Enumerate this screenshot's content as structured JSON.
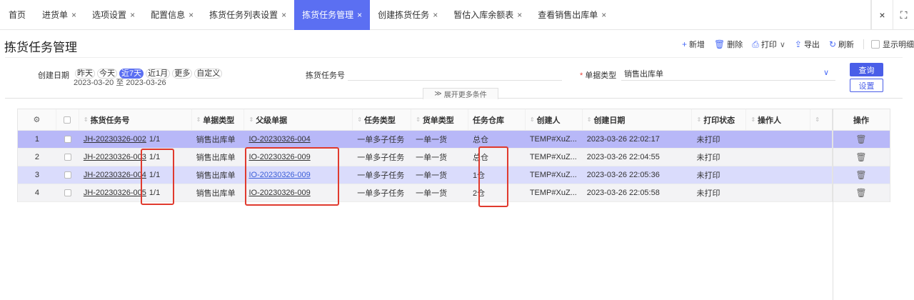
{
  "tabs": [
    {
      "label": "首页",
      "closable": false,
      "active": false
    },
    {
      "label": "进货单",
      "closable": true,
      "active": false
    },
    {
      "label": "选项设置",
      "closable": true,
      "active": false
    },
    {
      "label": "配置信息",
      "closable": true,
      "active": false
    },
    {
      "label": "拣货任务列表设置",
      "closable": true,
      "active": false
    },
    {
      "label": "拣货任务管理",
      "closable": true,
      "active": true
    },
    {
      "label": "创建拣货任务",
      "closable": true,
      "active": false
    },
    {
      "label": "暂估入库余额表",
      "closable": true,
      "active": false
    },
    {
      "label": "查看销售出库单",
      "closable": true,
      "active": false
    }
  ],
  "tab_close_glyph": "×",
  "window_controls": {
    "close": "×",
    "fullscreen": "⛶"
  },
  "page_title": "拣货任务管理",
  "toolbar": {
    "add": "新增",
    "delete": "删除",
    "print": "打印",
    "export": "导出",
    "refresh": "刷新",
    "show_detail": "显示明细"
  },
  "filter": {
    "date_label": "创建日期",
    "date_options": [
      "昨天",
      "今天",
      "近7天",
      "近1月",
      "更多",
      "自定义"
    ],
    "date_selected": "近7天",
    "date_range": "2023-03-20 至 2023-03-26",
    "task_no_label": "拣货任务号",
    "task_no_value": "",
    "type_label": "单据类型",
    "type_value": "销售出库单",
    "query_btn": "查询",
    "setting_btn": "设置",
    "expand_label": "展开更多条件"
  },
  "table": {
    "columns": [
      "拣货任务号",
      "单据类型",
      "父级单据",
      "任务类型",
      "货单类型",
      "任务仓库",
      "创建人",
      "创建日期",
      "打印状态",
      "操作人",
      "操作"
    ],
    "rows": [
      {
        "idx": "1",
        "task_no": "JH-20230326-002",
        "count": "1/1",
        "doc_type": "销售出库单",
        "parent": "IO-20230326-004",
        "task_type": "一单多子任务",
        "order_type": "一单一货",
        "warehouse": "总仓",
        "creator": "TEMP#XuZ...",
        "created": "2023-03-26 22:02:17",
        "print": "未打印",
        "operator": ""
      },
      {
        "idx": "2",
        "task_no": "JH-20230326-003",
        "count": "1/1",
        "doc_type": "销售出库单",
        "parent": "IO-20230326-009",
        "task_type": "一单多子任务",
        "order_type": "一单一货",
        "warehouse": "总仓",
        "creator": "TEMP#XuZ...",
        "created": "2023-03-26 22:04:55",
        "print": "未打印",
        "operator": ""
      },
      {
        "idx": "3",
        "task_no": "JH-20230326-004",
        "count": "1/1",
        "doc_type": "销售出库单",
        "parent": "IO-20230326-009",
        "task_type": "一单多子任务",
        "order_type": "一单一货",
        "warehouse": "1仓",
        "creator": "TEMP#XuZ...",
        "created": "2023-03-26 22:05:36",
        "print": "未打印",
        "operator": ""
      },
      {
        "idx": "4",
        "task_no": "JH-20230326-005",
        "count": "1/1",
        "doc_type": "销售出库单",
        "parent": "IO-20230326-009",
        "task_type": "一单多子任务",
        "order_type": "一单一货",
        "warehouse": "2仓",
        "creator": "TEMP#XuZ...",
        "created": "2023-03-26 22:05:58",
        "print": "未打印",
        "operator": ""
      }
    ]
  },
  "icons": {
    "gear": "gear-icon",
    "delete_row": "trash-icon",
    "sort": "sort-icon"
  },
  "colors": {
    "accent": "#5b6ff2",
    "row_selected": "#b8b8f8",
    "row_alt": "#dadcfc",
    "annotation": "#e03a2e"
  }
}
